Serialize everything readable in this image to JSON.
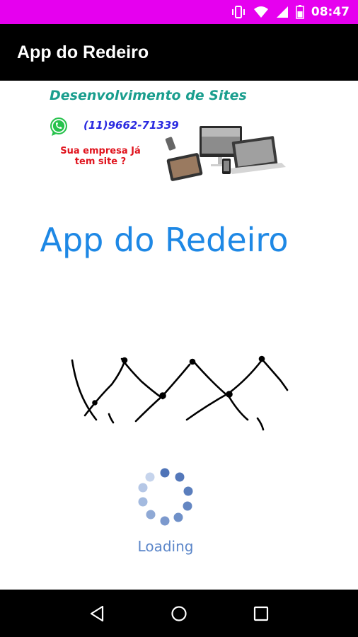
{
  "status_bar": {
    "time": "08:47",
    "icons": [
      "vibrate-icon",
      "wifi-icon",
      "signal-icon",
      "battery-icon"
    ],
    "background_color": "#e600ef"
  },
  "app_bar": {
    "title": "App do Redeiro",
    "background_color": "#000000"
  },
  "banner": {
    "headline": "Desenvolvimento de Sites",
    "phone": "(11)9662-71339",
    "promo_line1": "Sua empresa Já",
    "promo_line2": "tem site ?",
    "icons": [
      "whatsapp-icon",
      "devices-illustration"
    ]
  },
  "main": {
    "heading": "App do Redeiro",
    "heading_color": "#1e88e5",
    "image": "net-illustration",
    "loading_label": "Loading",
    "loading_color": "#5b86c9"
  },
  "nav_bar": {
    "icons": [
      "back-icon",
      "home-icon",
      "recents-icon"
    ]
  }
}
